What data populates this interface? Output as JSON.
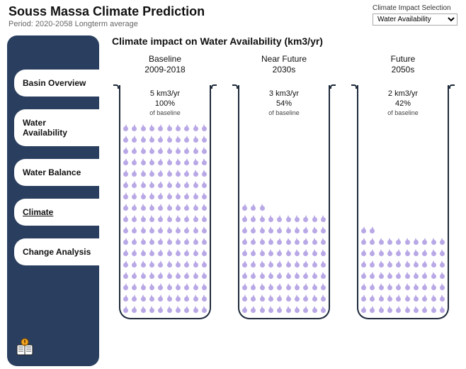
{
  "header": {
    "title": "Souss Massa Climate Prediction",
    "subtitle": "Period: 2020-2058 Longterm average"
  },
  "selector": {
    "label": "Climate Impact Selection",
    "selected": "Water Availability"
  },
  "sidebar": {
    "tabs": [
      {
        "label": "Basin Overview",
        "active": false
      },
      {
        "label": "Water Availability",
        "active": false
      },
      {
        "label": "Water Balance",
        "active": false
      },
      {
        "label": "Climate",
        "active": true
      },
      {
        "label": "Change Analysis",
        "active": false
      }
    ]
  },
  "main": {
    "title": "Climate impact on Water Availability (km3/yr)",
    "of_baseline_label": "of baseline"
  },
  "chart_data": {
    "type": "bar",
    "unit": "km3/yr",
    "max_rows": 17,
    "cols_per_row": 10,
    "scenarios": [
      {
        "name": "Baseline",
        "period": "2009-2018",
        "value": 5,
        "value_label": "5 km3/yr",
        "percent": 100,
        "percent_label": "100%",
        "fill_rows": 17,
        "last_row_count": 10
      },
      {
        "name": "Near Future",
        "period": "2030s",
        "value": 3,
        "value_label": "3 km3/yr",
        "percent": 54,
        "percent_label": "54%",
        "fill_rows": 10,
        "last_row_count": 3
      },
      {
        "name": "Future",
        "period": "2050s",
        "value": 2,
        "value_label": "2 km3/yr",
        "percent": 42,
        "percent_label": "42%",
        "fill_rows": 8,
        "last_row_count": 2
      }
    ]
  }
}
